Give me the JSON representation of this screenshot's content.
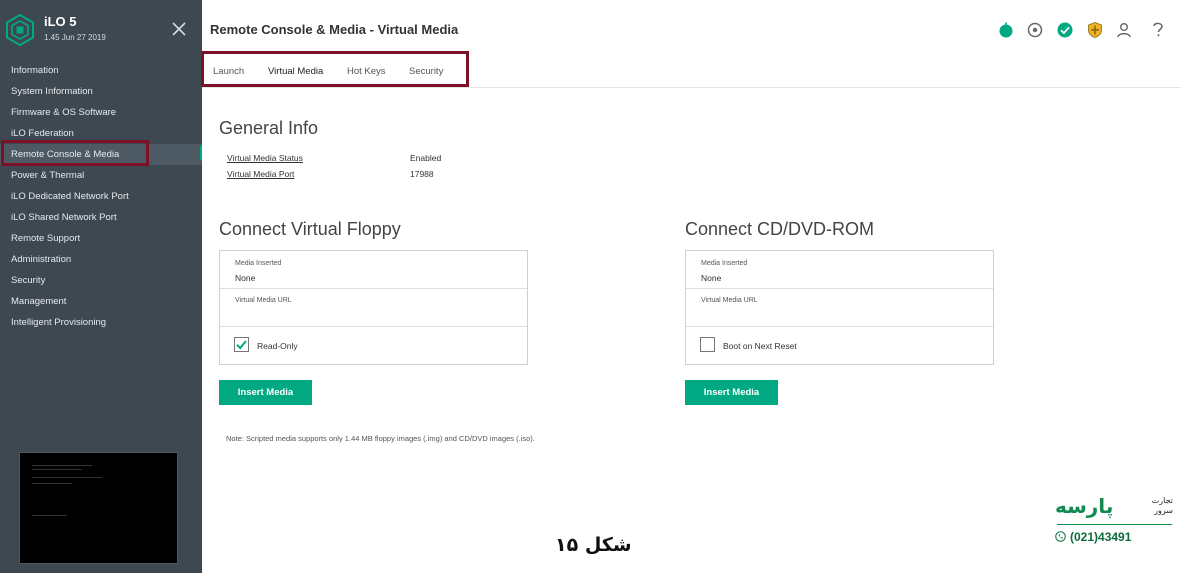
{
  "sidebar": {
    "brand_title": "iLO 5",
    "brand_sub": "1.45 Jun 27 2019",
    "items": [
      {
        "label": "Information"
      },
      {
        "label": "System Information"
      },
      {
        "label": "Firmware & OS Software"
      },
      {
        "label": "iLO Federation"
      },
      {
        "label": "Remote Console & Media"
      },
      {
        "label": "Power & Thermal"
      },
      {
        "label": "iLO Dedicated Network Port"
      },
      {
        "label": "iLO Shared Network Port"
      },
      {
        "label": "Remote Support"
      },
      {
        "label": "Administration"
      },
      {
        "label": "Security"
      },
      {
        "label": "Management"
      },
      {
        "label": "Intelligent Provisioning"
      }
    ],
    "active_item": "Remote Console & Media"
  },
  "header": {
    "title": "Remote Console & Media - Virtual Media",
    "icons": [
      "health-icon",
      "target-icon",
      "check-status-icon",
      "security-shield-icon",
      "user-icon",
      "help-icon"
    ]
  },
  "tabs": [
    {
      "label": "Launch"
    },
    {
      "label": "Virtual Media"
    },
    {
      "label": "Hot Keys"
    },
    {
      "label": "Security"
    }
  ],
  "active_tab": "Virtual Media",
  "general_info": {
    "heading": "General Info",
    "rows": [
      {
        "label": "Virtual Media Status",
        "value": "Enabled"
      },
      {
        "label": "Virtual Media Port",
        "value": "17988"
      }
    ]
  },
  "floppy": {
    "heading": "Connect Virtual Floppy",
    "media_inserted_label": "Media Inserted",
    "media_inserted_value": "None",
    "url_label": "Virtual Media URL",
    "url_value": "",
    "checkbox_label": "Read-Only",
    "checkbox_checked": true,
    "button": "Insert Media"
  },
  "cdrom": {
    "heading": "Connect CD/DVD-ROM",
    "media_inserted_label": "Media Inserted",
    "media_inserted_value": "None",
    "url_label": "Virtual Media URL",
    "url_value": "",
    "checkbox_label": "Boot on Next Reset",
    "checkbox_checked": false,
    "button": "Insert Media"
  },
  "note": "Note: Scripted media supports only 1.44 MB floppy images (.img) and CD/DVD images (.iso).",
  "caption": "شکل ۱۵",
  "watermark": {
    "brand": "پارسه",
    "tagline": "تجارت سرور",
    "phone": "(021)43491"
  },
  "colors": {
    "accent": "#01a982",
    "sidebar_bg": "#3d4851",
    "highlight_box": "#7b1228"
  }
}
